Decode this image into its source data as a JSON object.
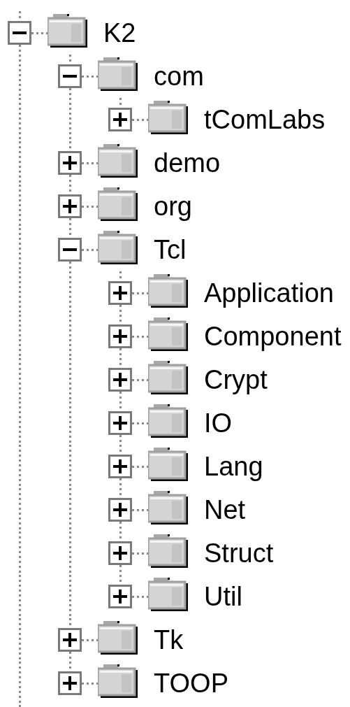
{
  "tree": [
    {
      "label": "K2",
      "expanded": true,
      "children": [
        {
          "label": "com",
          "expanded": true,
          "children": [
            {
              "label": "tComLabs",
              "expanded": false
            }
          ]
        },
        {
          "label": "demo",
          "expanded": false
        },
        {
          "label": "org",
          "expanded": false
        },
        {
          "label": "Tcl",
          "expanded": true,
          "children": [
            {
              "label": "Application",
              "expanded": false
            },
            {
              "label": "Component",
              "expanded": false
            },
            {
              "label": "Crypt",
              "expanded": false
            },
            {
              "label": "IO",
              "expanded": false
            },
            {
              "label": "Lang",
              "expanded": false
            },
            {
              "label": "Net",
              "expanded": false
            },
            {
              "label": "Struct",
              "expanded": false
            },
            {
              "label": "Util",
              "expanded": false
            }
          ]
        },
        {
          "label": "Tk",
          "expanded": false
        },
        {
          "label": "TOOP",
          "expanded": false
        }
      ]
    }
  ]
}
